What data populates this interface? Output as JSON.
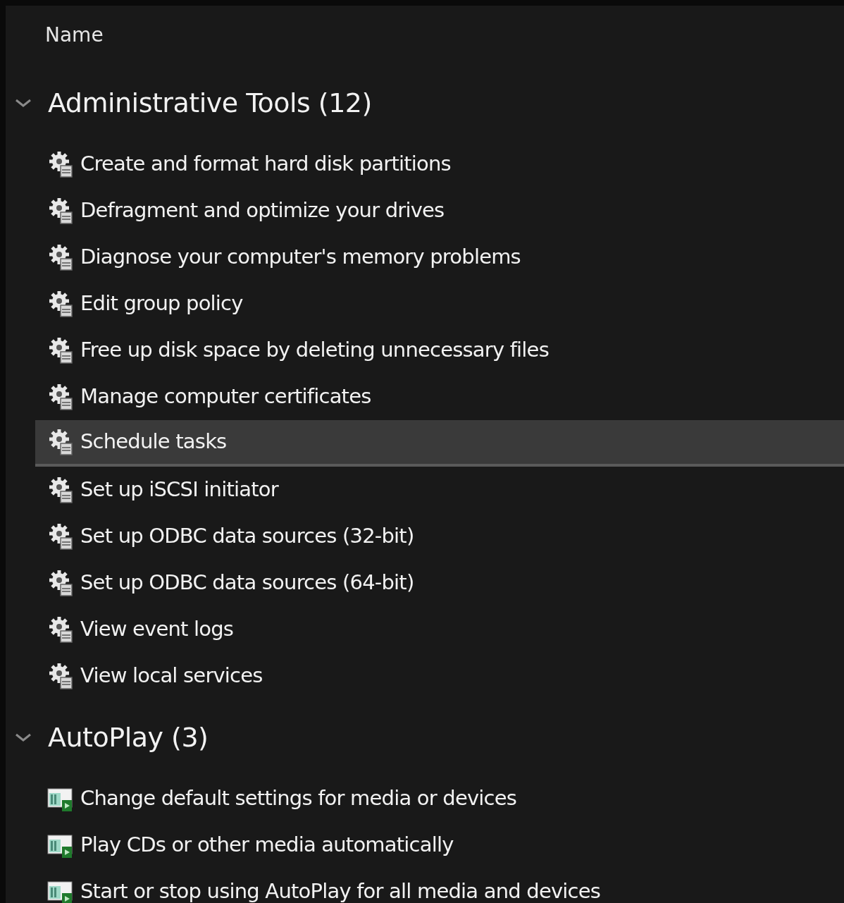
{
  "header": {
    "column": "Name"
  },
  "groups": [
    {
      "title": "Administrative Tools (12)",
      "expanded": true,
      "items": [
        {
          "label": "Create and format hard disk partitions",
          "kind": "tool",
          "selected": false
        },
        {
          "label": "Defragment and optimize your drives",
          "kind": "tool",
          "selected": false
        },
        {
          "label": "Diagnose your computer's memory problems",
          "kind": "tool",
          "selected": false
        },
        {
          "label": "Edit group policy",
          "kind": "tool",
          "selected": false
        },
        {
          "label": "Free up disk space by deleting unnecessary files",
          "kind": "tool",
          "selected": false
        },
        {
          "label": "Manage computer certificates",
          "kind": "tool",
          "selected": false
        },
        {
          "label": "Schedule tasks",
          "kind": "tool",
          "selected": true
        },
        {
          "label": "Set up iSCSI initiator",
          "kind": "tool",
          "selected": false
        },
        {
          "label": "Set up ODBC data sources (32-bit)",
          "kind": "tool",
          "selected": false
        },
        {
          "label": "Set up ODBC data sources (64-bit)",
          "kind": "tool",
          "selected": false
        },
        {
          "label": "View event logs",
          "kind": "tool",
          "selected": false
        },
        {
          "label": "View local services",
          "kind": "tool",
          "selected": false
        }
      ]
    },
    {
      "title": "AutoPlay (3)",
      "expanded": true,
      "items": [
        {
          "label": "Change default settings for media or devices",
          "kind": "autoplay",
          "selected": false
        },
        {
          "label": "Play CDs or other media automatically",
          "kind": "autoplay",
          "selected": false
        },
        {
          "label": "Start or stop using AutoPlay for all media and devices",
          "kind": "autoplay",
          "selected": false
        }
      ]
    }
  ]
}
